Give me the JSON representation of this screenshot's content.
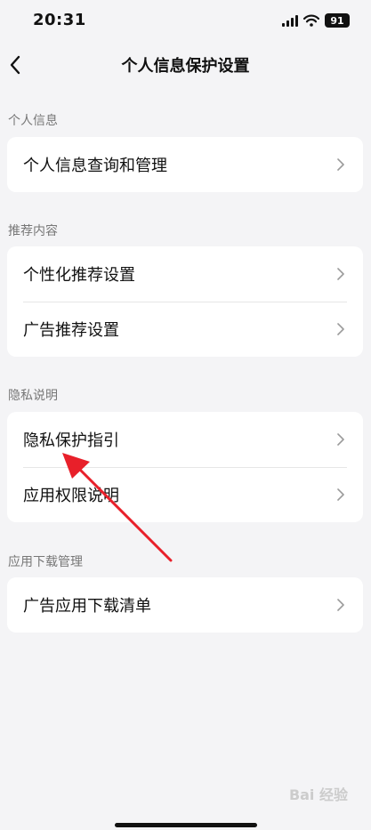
{
  "status_bar": {
    "time": "20:31",
    "battery": "91",
    "icons": [
      "signal-icon",
      "wifi-icon",
      "battery-icon"
    ]
  },
  "nav": {
    "title": "个人信息保护设置",
    "back_icon": "chevron-left-icon"
  },
  "sections": [
    {
      "header": "个人信息",
      "items": [
        {
          "label": "个人信息查询和管理"
        }
      ]
    },
    {
      "header": "推荐内容",
      "items": [
        {
          "label": "个性化推荐设置"
        },
        {
          "label": "广告推荐设置"
        }
      ]
    },
    {
      "header": "隐私说明",
      "items": [
        {
          "label": "隐私保护指引"
        },
        {
          "label": "应用权限说明"
        }
      ]
    },
    {
      "header": "应用下载管理",
      "items": [
        {
          "label": "广告应用下载清单"
        }
      ]
    }
  ],
  "watermark": "Bai 经验",
  "colors": {
    "background": "#f4f4f6",
    "card": "#ffffff",
    "annotation_arrow": "#e8202a",
    "section_header_text": "#777777"
  }
}
